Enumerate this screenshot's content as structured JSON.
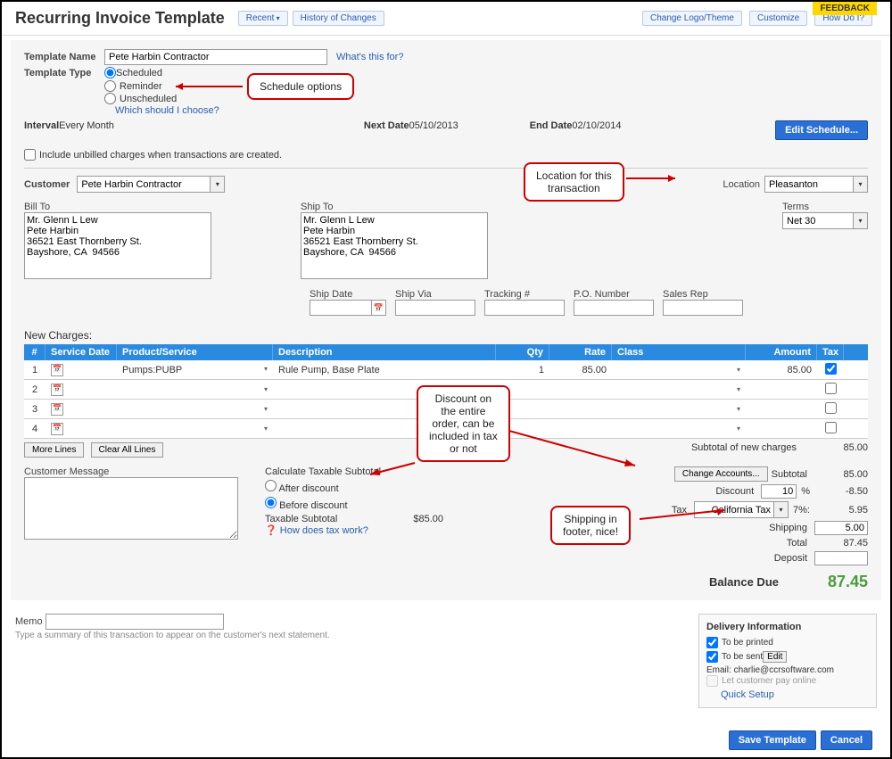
{
  "header": {
    "title": "Recurring Invoice Template",
    "recent": "Recent",
    "history": "History of Changes",
    "change_logo": "Change Logo/Theme",
    "customize": "Customize",
    "how_do_i": "How Do I?",
    "feedback": "FEEDBACK"
  },
  "template": {
    "name_label": "Template Name",
    "name_value": "Pete Harbin Contractor",
    "whats_this": "What's this for?",
    "type_label": "Template Type",
    "opt_scheduled": "Scheduled",
    "opt_reminder": "Reminder",
    "opt_unscheduled": "Unscheduled",
    "which_choose": "Which should I choose?"
  },
  "schedule": {
    "interval_label": "Interval",
    "interval_value": "Every Month",
    "next_label": "Next Date",
    "next_value": "05/10/2013",
    "end_label": "End Date",
    "end_value": "02/10/2014",
    "edit_btn": "Edit Schedule...",
    "include_unbilled": "Include unbilled charges when transactions are created."
  },
  "customer": {
    "label": "Customer",
    "value": "Pete Harbin Contractor",
    "location_label": "Location",
    "location_value": "Pleasanton"
  },
  "billto": {
    "label": "Bill To",
    "value": "Mr. Glenn L Lew\nPete Harbin\n36521 East Thornberry St.\nBayshore, CA  94566"
  },
  "shipto": {
    "label": "Ship To",
    "value": "Mr. Glenn L Lew\nPete Harbin\n36521 East Thornberry St.\nBayshore, CA  94566"
  },
  "terms": {
    "label": "Terms",
    "value": "Net 30"
  },
  "shipfields": {
    "ship_date": "Ship Date",
    "ship_via": "Ship Via",
    "tracking": "Tracking #",
    "po": "P.O. Number",
    "sales_rep": "Sales Rep"
  },
  "table": {
    "title": "New Charges:",
    "col_num": "#",
    "col_date": "Service Date",
    "col_prod": "Product/Service",
    "col_desc": "Description",
    "col_qty": "Qty",
    "col_rate": "Rate",
    "col_class": "Class",
    "col_amt": "Amount",
    "col_tax": "Tax",
    "rows": [
      {
        "num": "1",
        "product": "Pumps:PUBP",
        "desc": "Rule Pump, Base Plate",
        "qty": "1",
        "rate": "85.00",
        "amount": "85.00",
        "tax": true
      },
      {
        "num": "2",
        "product": "",
        "desc": "",
        "qty": "",
        "rate": "",
        "amount": "",
        "tax": false
      },
      {
        "num": "3",
        "product": "",
        "desc": "",
        "qty": "",
        "rate": "",
        "amount": "",
        "tax": false
      },
      {
        "num": "4",
        "product": "",
        "desc": "",
        "qty": "",
        "rate": "",
        "amount": "",
        "tax": false
      }
    ],
    "more_lines": "More Lines",
    "clear_lines": "Clear All Lines"
  },
  "totals": {
    "subtotal_new_label": "Subtotal of new charges",
    "subtotal_new": "85.00",
    "change_accounts": "Change Accounts...",
    "subtotal_label": "Subtotal",
    "subtotal": "85.00",
    "discount_label": "Discount",
    "discount_pct": "10",
    "discount_amt": "-8.50",
    "tax_label": "Tax",
    "tax_name": "California Tax",
    "tax_pct": "7%:",
    "tax_amt": "5.95",
    "shipping_label": "Shipping",
    "shipping_amt": "5.00",
    "total_label": "Total",
    "total_amt": "87.45",
    "deposit_label": "Deposit",
    "balance_label": "Balance Due",
    "balance_amt": "87.45"
  },
  "custmsg": {
    "label": "Customer Message"
  },
  "taxable": {
    "title": "Calculate Taxable Subtotal",
    "after": "After discount",
    "before": "Before discount",
    "sub_label": "Taxable Subtotal",
    "sub_val": "$85.00",
    "help": "How does tax work?"
  },
  "memo": {
    "label": "Memo",
    "hint": "Type a summary of this transaction to appear on the customer's next statement."
  },
  "delivery": {
    "title": "Delivery Information",
    "printed": "To be printed",
    "sent": "To be sent",
    "edit": "Edit",
    "email_label": "Email:",
    "email": "charlie@ccrsoftware.com",
    "pay_online": "Let customer pay online",
    "quick_setup": "Quick Setup"
  },
  "footer": {
    "save": "Save Template",
    "cancel": "Cancel"
  },
  "callouts": {
    "schedule": "Schedule options",
    "location": "Location for this\ntransaction",
    "discount": "Discount on\nthe entire\norder, can be\nincluded in tax\nor not",
    "shipping": "Shipping in\nfooter, nice!"
  }
}
